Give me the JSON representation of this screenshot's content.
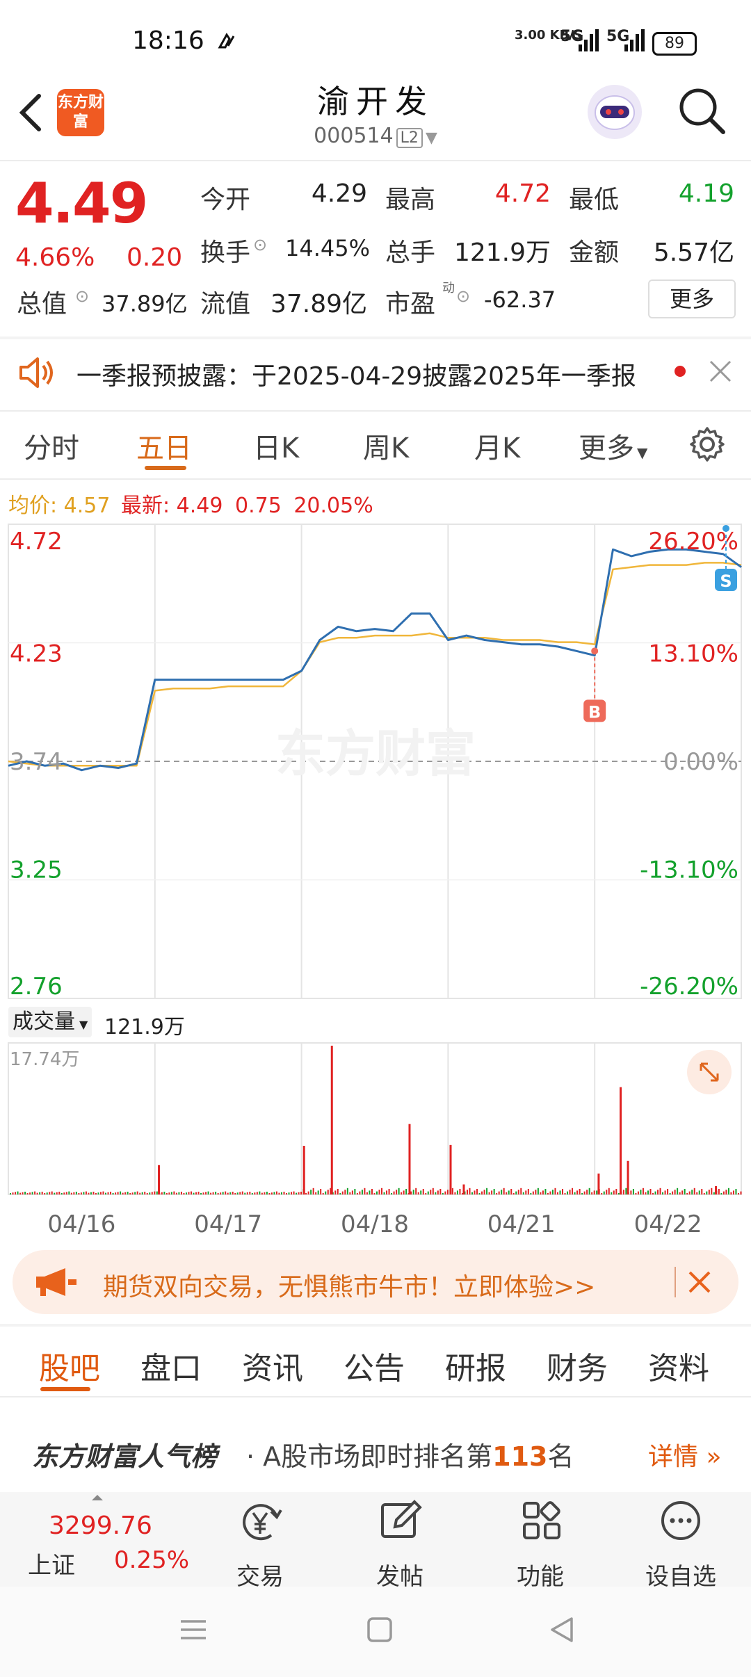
{
  "status_bar": {
    "time": "18:16",
    "net_speed": "3.00 KB/S",
    "signal1": "5G",
    "signal2": "5G",
    "battery": "89"
  },
  "header": {
    "logo_text": "东方财富",
    "stock_name": "渝开发",
    "stock_code": "000514",
    "level_badge": "L2"
  },
  "quote": {
    "price": "4.49",
    "change_pct": "4.66%",
    "change": "0.20",
    "open_label": "今开",
    "open": "4.29",
    "high_label": "最高",
    "high": "4.72",
    "low_label": "最低",
    "low": "4.19",
    "turnover_label": "换手",
    "turnover": "14.45%",
    "volume_label": "总手",
    "volume": "121.9万",
    "amount_label": "金额",
    "amount": "5.57亿",
    "mktcap_label": "总值",
    "mktcap": "37.89亿",
    "float_label": "流值",
    "float_cap": "37.89亿",
    "pe_label": "市盈",
    "pe_sup": "动",
    "pe": "-62.37",
    "more_label": "更多"
  },
  "notice": {
    "text": "一季报预披露：于2025-04-29披露2025年一季报"
  },
  "tabs": [
    "分时",
    "五日",
    "日K",
    "周K",
    "月K",
    "更多"
  ],
  "chart_info": {
    "avg_label": "均价:",
    "avg": "4.57",
    "latest_label": "最新:",
    "latest": "4.49",
    "latest_change": "0.75",
    "latest_pct": "20.05%"
  },
  "chart_data": {
    "type": "line",
    "title": "",
    "x": [
      "04/16",
      "04/17",
      "04/18",
      "04/21",
      "04/22"
    ],
    "series": [
      {
        "name": "最新",
        "color": "#2f6fb0",
        "values": [
          3.72,
          3.74,
          3.72,
          3.73,
          3.7,
          3.72,
          3.71,
          3.73,
          4.11,
          4.11,
          4.11,
          4.11,
          4.11,
          4.11,
          4.11,
          4.11,
          4.15,
          4.29,
          4.35,
          4.33,
          4.34,
          4.33,
          4.41,
          4.41,
          4.29,
          4.31,
          4.29,
          4.28,
          4.27,
          4.27,
          4.26,
          4.24,
          4.22,
          4.7,
          4.67,
          4.69,
          4.7,
          4.7,
          4.69,
          4.68,
          4.62
        ]
      },
      {
        "name": "均价",
        "color": "#f0b63a",
        "values": [
          3.74,
          3.73,
          3.72,
          3.72,
          3.72,
          3.72,
          3.72,
          3.72,
          4.06,
          4.07,
          4.07,
          4.07,
          4.08,
          4.08,
          4.08,
          4.08,
          4.15,
          4.28,
          4.3,
          4.3,
          4.31,
          4.31,
          4.31,
          4.32,
          4.3,
          4.3,
          4.3,
          4.29,
          4.29,
          4.29,
          4.28,
          4.28,
          4.27,
          4.61,
          4.62,
          4.63,
          4.63,
          4.63,
          4.64,
          4.64,
          4.63
        ]
      }
    ],
    "y_left_ticks": [
      "4.72",
      "4.23",
      "3.74",
      "3.25",
      "2.76"
    ],
    "y_right_ticks": [
      "26.20%",
      "13.10%",
      "0.00%",
      "-13.10%",
      "-26.20%"
    ],
    "ylim": [
      2.76,
      4.72
    ],
    "markers": [
      {
        "label": "B",
        "color": "#ee6a5a"
      },
      {
        "label": "S",
        "color": "#3aa0e0"
      }
    ],
    "watermark": "东方财富",
    "volume": {
      "label": "成交量",
      "total": "121.9万",
      "max_label": "17.74万",
      "spikes": [
        {
          "day": 1,
          "pos": 0.02,
          "value": 3.5
        },
        {
          "day": 2,
          "pos": 0.01,
          "value": 5.8
        },
        {
          "day": 2,
          "pos": 0.2,
          "value": 17.74
        },
        {
          "day": 2,
          "pos": 0.73,
          "value": 8.4
        },
        {
          "day": 3,
          "pos": 0.01,
          "value": 5.9
        },
        {
          "day": 3,
          "pos": 0.1,
          "value": 1.2
        },
        {
          "day": 4,
          "pos": 0.02,
          "value": 2.5
        },
        {
          "day": 4,
          "pos": 0.17,
          "value": 12.8
        },
        {
          "day": 4,
          "pos": 0.22,
          "value": 4.0
        },
        {
          "day": 4,
          "pos": 0.82,
          "value": 1.0
        }
      ]
    }
  },
  "banner": {
    "text": "期货双向交易，无惧熊市牛市！立即体验>>"
  },
  "bottom_tabs": [
    "股吧",
    "盘口",
    "资讯",
    "公告",
    "研报",
    "财务",
    "资料"
  ],
  "rank": {
    "brand": "东方财富人气榜",
    "text_prefix": "· A股市场即时排名第",
    "rank": "113",
    "text_suffix": "名",
    "detail": "详情"
  },
  "index": {
    "value": "3299.76",
    "name": "上证",
    "pct": "0.25%"
  },
  "nav": [
    {
      "label": "交易"
    },
    {
      "label": "发帖"
    },
    {
      "label": "功能"
    },
    {
      "label": "设自选"
    }
  ]
}
